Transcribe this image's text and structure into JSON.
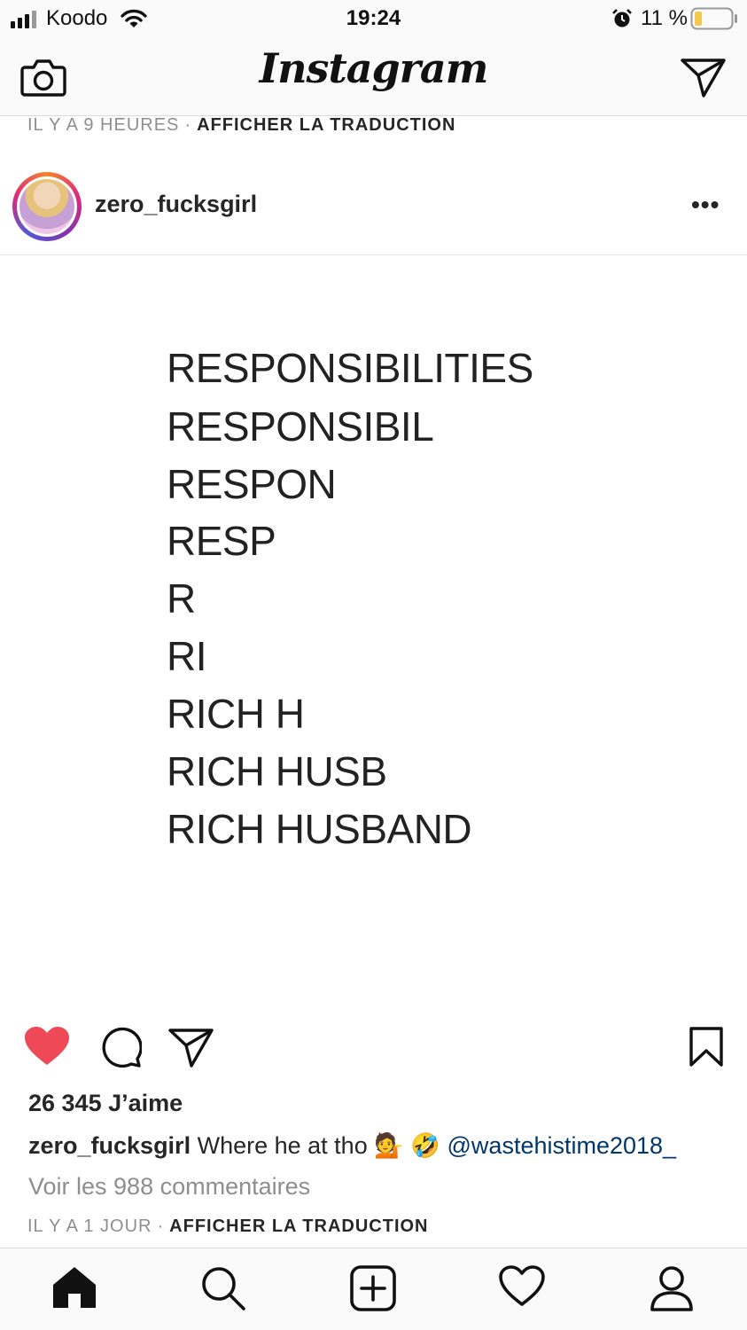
{
  "status_bar": {
    "carrier": "Koodo",
    "time": "19:24",
    "battery": "11 %",
    "icons": [
      "signal-icon",
      "wifi-icon",
      "alarm-icon",
      "battery-icon"
    ]
  },
  "nav": {
    "title": "Instagram",
    "icons": [
      "camera-icon",
      "direct-message-icon"
    ]
  },
  "previous_post": {
    "time_ago": "IL Y A 9 HEURES",
    "separator": "·",
    "translate": "AFFICHER LA TRADUCTION"
  },
  "post": {
    "username": "zero_fucksgirl",
    "more": "•••",
    "image_text": [
      "RESPONSIBILITIES",
      "RESPONSIBIL",
      "RESPON",
      "RESP",
      "R",
      "RI",
      "RICH H",
      "RICH HUSB",
      "RICH HUSBAND"
    ],
    "liked": true,
    "likes": "26 345 J’aime",
    "caption_user": "zero_fucksgirl",
    "caption_text": "Where he at tho",
    "caption_emojis": [
      "💁",
      "🤣"
    ],
    "caption_mention": "@wastehistime2018_",
    "view_comments": "Voir les 988 commentaires",
    "time_ago": "IL Y A 1 JOUR",
    "separator": "·",
    "translate": "AFFICHER LA TRADUCTION",
    "colors": {
      "like": "#ed4956",
      "mention": "#00376b"
    }
  },
  "tab_bar": [
    "home-icon",
    "search-icon",
    "new-post-icon",
    "activity-heart-icon",
    "profile-icon"
  ]
}
